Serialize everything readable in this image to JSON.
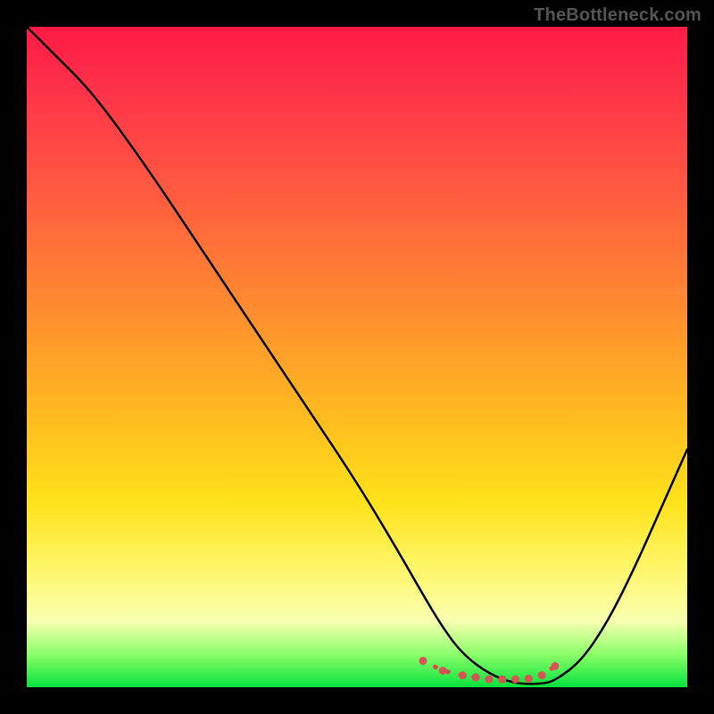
{
  "watermark": "TheBottleneck.com",
  "chart_data": {
    "type": "line",
    "title": "",
    "xlabel": "",
    "ylabel": "",
    "xlim": [
      0,
      100
    ],
    "ylim": [
      0,
      100
    ],
    "series": [
      {
        "name": "black-curve",
        "x": [
          0,
          4,
          10,
          18,
          26,
          34,
          42,
          50,
          56,
          60,
          63,
          66,
          70,
          74,
          78,
          80,
          84,
          88,
          92,
          96,
          100
        ],
        "values": [
          100,
          96,
          90,
          79,
          67,
          55,
          43,
          31,
          21,
          14,
          9,
          5,
          2,
          0.5,
          0.5,
          1,
          4,
          10,
          18,
          27,
          36
        ]
      },
      {
        "name": "red-bottom-marks",
        "x": [
          60,
          63,
          66,
          68,
          70,
          72,
          74,
          76,
          78,
          80
        ],
        "values": [
          4.0,
          2.5,
          1.8,
          1.5,
          1.2,
          1.2,
          1.2,
          1.3,
          1.8,
          3.2
        ]
      }
    ],
    "gradient_stops": [
      {
        "pos": 0,
        "color": "#ff1a44"
      },
      {
        "pos": 25,
        "color": "#ff5a40"
      },
      {
        "pos": 58,
        "color": "#ffb820"
      },
      {
        "pos": 82,
        "color": "#fff66a"
      },
      {
        "pos": 95,
        "color": "#8cff6a"
      },
      {
        "pos": 100,
        "color": "#06e23c"
      }
    ]
  }
}
